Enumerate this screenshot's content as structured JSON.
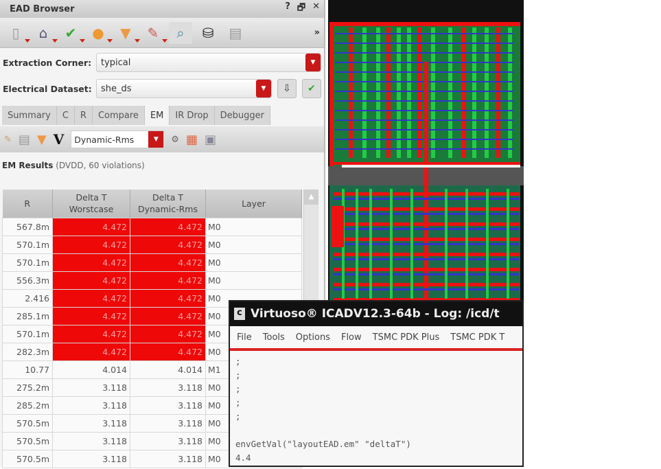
{
  "ead": {
    "title": "EAD Browser",
    "ctrls": [
      "?",
      "🗗",
      "✕"
    ],
    "more": "»",
    "toolbar_icons": [
      "probe-icon",
      "netlist-icon",
      "check-icon",
      "globe-icon",
      "filter-icon",
      "highlight-icon",
      "zoom-icon",
      "binoculars-icon",
      "table-icon"
    ],
    "extraction_label": "Extraction Corner:",
    "extraction_value": "typical",
    "dataset_label": "Electrical Dataset:",
    "dataset_value": "she_ds",
    "tabs": [
      "Summary",
      "C",
      "R",
      "Compare",
      "EM",
      "IR Drop",
      "Debugger"
    ],
    "active_tab": "EM",
    "em_select": "Dynamic-Rms",
    "em_v": "V",
    "results_title": "EM Results",
    "results_detail": "(DVDD, 60 violations)",
    "columns": [
      "R",
      "Delta T\nWorstcase",
      "Delta T\nDynamic-Rms",
      "Layer"
    ],
    "rows": [
      [
        "567.8m",
        "4.472",
        "4.472",
        "M0",
        true
      ],
      [
        "570.1m",
        "4.472",
        "4.472",
        "M0",
        true
      ],
      [
        "570.1m",
        "4.472",
        "4.472",
        "M0",
        true
      ],
      [
        "556.3m",
        "4.472",
        "4.472",
        "M0",
        true
      ],
      [
        "2.416",
        "4.472",
        "4.472",
        "M0",
        true
      ],
      [
        "285.1m",
        "4.472",
        "4.472",
        "M0",
        true
      ],
      [
        "570.1m",
        "4.472",
        "4.472",
        "M0",
        true
      ],
      [
        "282.3m",
        "4.472",
        "4.472",
        "M0",
        true
      ],
      [
        "10.77",
        "4.014",
        "4.014",
        "M1",
        false
      ],
      [
        "275.2m",
        "3.118",
        "3.118",
        "M0",
        false
      ],
      [
        "285.2m",
        "3.118",
        "3.118",
        "M0",
        false
      ],
      [
        "570.5m",
        "3.118",
        "3.118",
        "M0",
        false
      ],
      [
        "570.5m",
        "3.118",
        "3.118",
        "M0",
        false
      ],
      [
        "570.5m",
        "3.118",
        "3.118",
        "M0",
        false
      ]
    ]
  },
  "log": {
    "title": "Virtuoso® ICADV12.3-64b - Log: /icd/t",
    "menu": [
      "File",
      "Tools",
      "Options",
      "Flow",
      "TSMC PDK Plus",
      "TSMC PDK T"
    ],
    "lines": [
      ";",
      ";",
      ";",
      ";",
      ";",
      "envGetVal(\"layoutEAD.em\" \"deltaT\")",
      "4.4"
    ]
  },
  "colors": {
    "violation": "#ee0808",
    "accent": "#c81818"
  }
}
